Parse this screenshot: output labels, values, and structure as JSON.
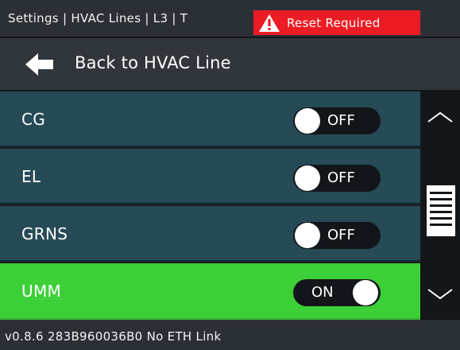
{
  "header": {
    "breadcrumb": "Settings | HVAC Lines | L3 | T",
    "alert": {
      "icon": "warning-icon",
      "text": "Reset Required",
      "color": "#ec1c24"
    }
  },
  "nav": {
    "back_icon": "arrow-left-icon",
    "back_label": "Back to HVAC Line"
  },
  "list": {
    "items": [
      {
        "label": "CG",
        "state": "OFF"
      },
      {
        "label": "EL",
        "state": "OFF"
      },
      {
        "label": "GRNS",
        "state": "OFF"
      },
      {
        "label": "UMM",
        "state": "ON"
      }
    ]
  },
  "scrollbar": {
    "up_icon": "chevron-up-icon",
    "down_icon": "chevron-down-icon"
  },
  "footer": {
    "text": "v0.8.6  283B960036B0  No ETH Link"
  },
  "colors": {
    "row_off_bg": "#264a56",
    "row_on_bg": "#3ccf37",
    "toggle_bg": "#12161a",
    "alert_bg": "#ec1c24"
  }
}
